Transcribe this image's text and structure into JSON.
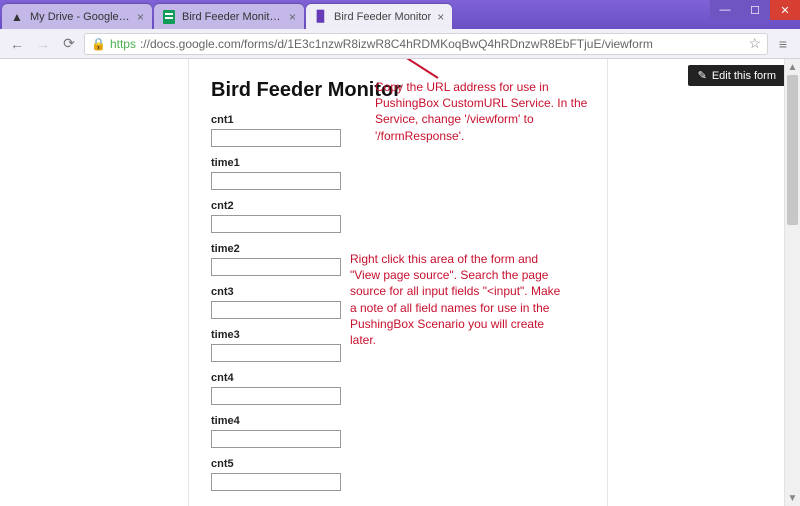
{
  "window": {
    "tabs": [
      {
        "label": "My Drive - Google Drive"
      },
      {
        "label": "Bird Feeder Monitor - Goo"
      },
      {
        "label": "Bird Feeder Monitor"
      }
    ]
  },
  "addressbar": {
    "https": "https",
    "rest": "://docs.google.com/forms/d/1E3c1nzwR8izwR8C4hRDMKoqBwQ4hRDnzwR8EbFTjuE/viewform"
  },
  "form": {
    "title": "Bird Feeder Monitor",
    "fields": [
      {
        "label": "cnt1",
        "value": ""
      },
      {
        "label": "time1",
        "value": ""
      },
      {
        "label": "cnt2",
        "value": ""
      },
      {
        "label": "time2",
        "value": ""
      },
      {
        "label": "cnt3",
        "value": ""
      },
      {
        "label": "time3",
        "value": ""
      },
      {
        "label": "cnt4",
        "value": ""
      },
      {
        "label": "time4",
        "value": ""
      },
      {
        "label": "cnt5",
        "value": ""
      }
    ]
  },
  "buttons": {
    "edit_form": "Edit this form"
  },
  "annotations": {
    "a1": "Copy the URL address for use in PushingBox CustomURL Service.  In the Service, change '/viewform' to '/formResponse'.",
    "a2": "Right click this area of the form and \"View page source\".  Search the page source for all input fields \"<input\".  Make a note of all field names for use in the PushingBox Scenario you will create later."
  },
  "colors": {
    "annotation": "#c8102e",
    "chrome": "#6b4fc5"
  }
}
